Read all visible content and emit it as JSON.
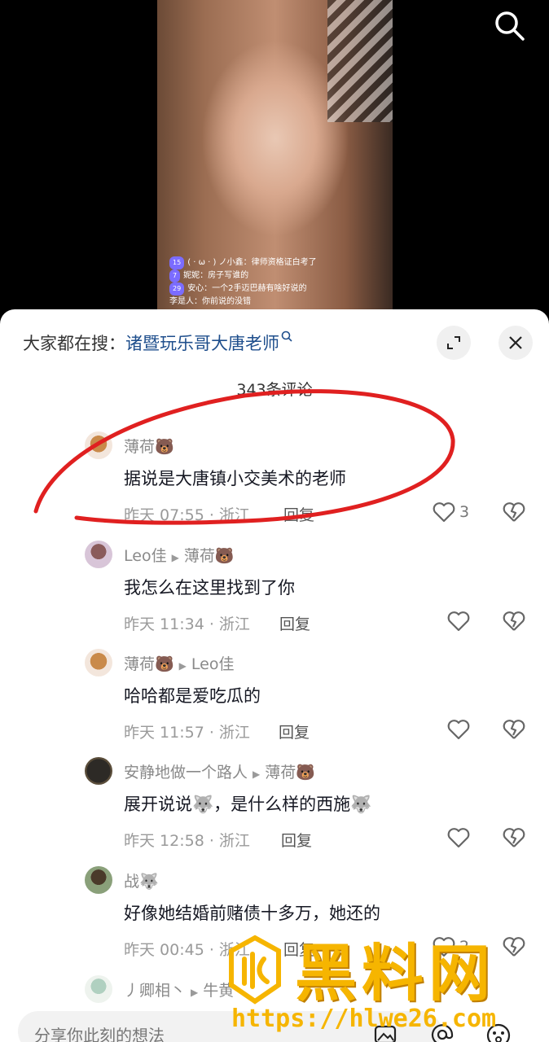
{
  "live": {
    "chat": [
      {
        "level": "15",
        "text": "( · ω · ) ノ小鑫：律师资格证白考了"
      },
      {
        "level": "7",
        "text": "妮妮：房子写谁的"
      },
      {
        "level": "29",
        "text": "安心：一个2手迈巴赫有啥好说的"
      },
      {
        "level": "",
        "text": "李是人：你前说的没错"
      }
    ]
  },
  "sheet": {
    "trend_prefix": "大家都在搜：",
    "trend_keyword": "诸暨玩乐哥大唐老师",
    "comment_count": "343条评论"
  },
  "comments": [
    {
      "user": "薄荷🐻",
      "reply_to": "",
      "text": "据说是大唐镇小交美术的老师",
      "time": "昨天 07:55 · 浙江",
      "reply": "回复",
      "likes": "3"
    },
    {
      "user": "Leo佳",
      "reply_to": "薄荷🐻",
      "text": "我怎么在这里找到了你",
      "time": "昨天 11:34 · 浙江",
      "reply": "回复",
      "likes": ""
    },
    {
      "user": "薄荷🐻",
      "reply_to": "Leo佳",
      "text": "哈哈都是爱吃瓜的",
      "time": "昨天 11:57 · 浙江",
      "reply": "回复",
      "likes": ""
    },
    {
      "user": "安静地做一个路人",
      "reply_to": "薄荷🐻",
      "text": "展开说说🐺，是什么样的西施🐺",
      "time": "昨天 12:58 · 浙江",
      "reply": "回复",
      "likes": ""
    },
    {
      "user": "战🐺",
      "reply_to": "",
      "text": "好像她结婚前赌债十多万，她还的",
      "time": "昨天 00:45 · 浙江",
      "reply": "回复",
      "likes": "2"
    },
    {
      "user": "丿卿相丶",
      "reply_to": "牛黄",
      "text": "",
      "time": "",
      "reply": "",
      "likes": ""
    }
  ],
  "input": {
    "placeholder": "分享你此刻的想法"
  },
  "watermark": {
    "logo_text": "黑料网",
    "url": "https://hlwe26.com"
  },
  "colors": {
    "annotation": "#e02020",
    "keyword": "#1e4e8c",
    "watermark": "#f6b500"
  }
}
